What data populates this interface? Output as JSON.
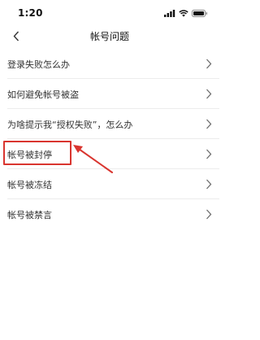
{
  "status_bar": {
    "time": "1:20",
    "icons": [
      "cellular-signal-icon",
      "wifi-icon",
      "battery-icon"
    ]
  },
  "nav": {
    "title": "帐号问题",
    "back_icon": "chevron-left-icon"
  },
  "items": [
    {
      "label": "登录失败怎么办"
    },
    {
      "label": "如何避免帐号被盗"
    },
    {
      "label": "为啥提示我“授权失败”，怎么办"
    },
    {
      "label": "帐号被封停"
    },
    {
      "label": "帐号被冻结"
    },
    {
      "label": "帐号被禁言"
    }
  ],
  "annotation": {
    "highlighted_item": "帐号被封停",
    "color": "#d9352f"
  }
}
